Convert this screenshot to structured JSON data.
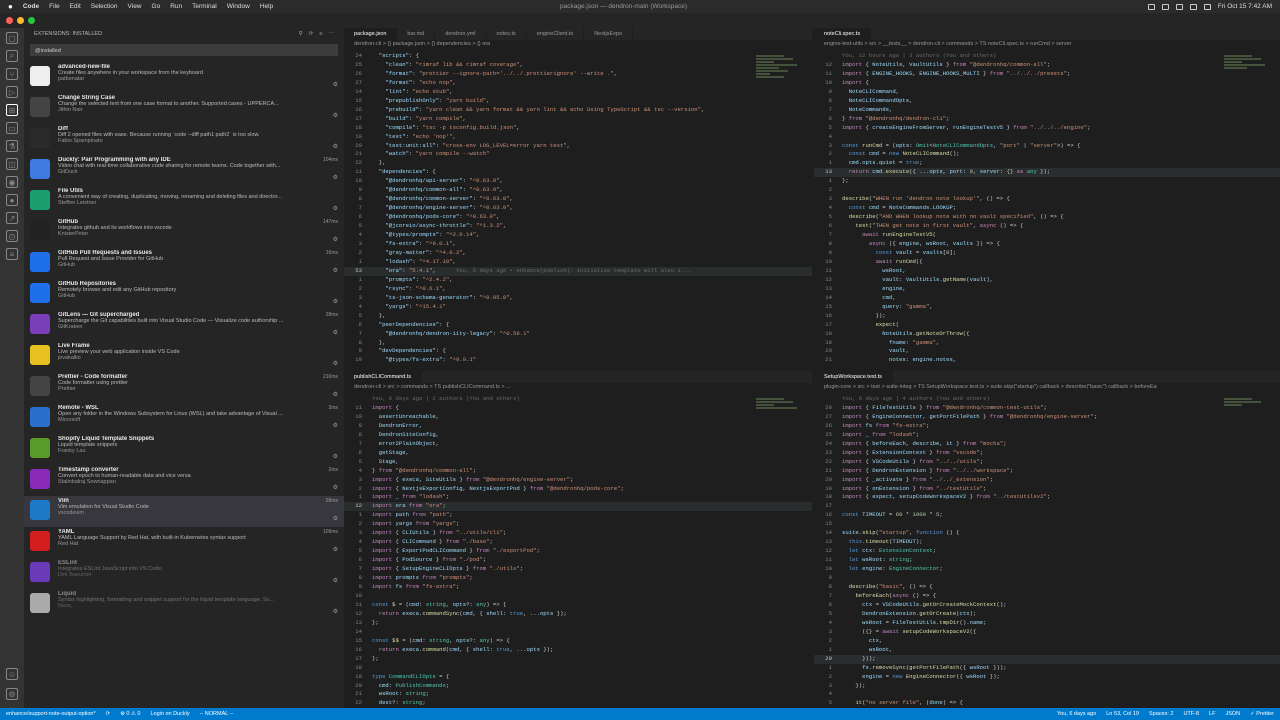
{
  "mac": {
    "app": "Code",
    "menu": [
      "File",
      "Edit",
      "Selection",
      "View",
      "Go",
      "Run",
      "Terminal",
      "Window",
      "Help"
    ],
    "center": "package.json — dendron-main (Workspace)",
    "time": "Fri Oct 15  7:42 AM"
  },
  "ext": {
    "title": "EXTENSIONS: INSTALLED",
    "search": "@installed",
    "items": [
      {
        "name": "advanced-new-file",
        "desc": "Create files anywhere in your workspace from the keyboard",
        "pub": "patbenatar",
        "dl": "",
        "color": "#eee",
        "icon": "file-icon"
      },
      {
        "name": "Change String Case",
        "desc": "Change the selected text from one case format to another. Supported cases - UPPERCA...",
        "pub": "Jithin Nair",
        "dl": "",
        "color": "#444",
        "icon": "text-icon"
      },
      {
        "name": "Diff",
        "desc": "Diff 2 opened files with ease. Because running `code --diff path1 path2` is too slow.",
        "pub": "Fabio Spampinato",
        "dl": "",
        "color": "#2a2a2a",
        "icon": "diff-icon"
      },
      {
        "name": "Duckly: Pair Programming with any IDE",
        "desc": "Video chat with real-time collaborative code sharing for remote teams. Code together with...",
        "pub": "GitDuck",
        "dl": "104ms",
        "color": "#3d7be0",
        "icon": "duck-icon"
      },
      {
        "name": "File Utils",
        "desc": "A convenient way of creating, duplicating, moving, renaming and deleting files and director...",
        "pub": "Steffen Leistner",
        "dl": "",
        "color": "#1a9d6f",
        "icon": "folder-icon"
      },
      {
        "name": "GitHub",
        "desc": "Integrates github and its workflows into vscode",
        "pub": "KnisterPeter",
        "dl": "147ms",
        "color": "#222",
        "icon": "github-icon"
      },
      {
        "name": "GitHub Pull Requests and Issues",
        "desc": "Pull Request and Issue Provider for GitHub",
        "pub": "GitHub",
        "dl": "16ms",
        "color": "#1f6feb",
        "icon": "pr-icon"
      },
      {
        "name": "GitHub Repositories",
        "desc": "Remotely browse and edit any GitHub repository",
        "pub": "GitHub",
        "dl": "",
        "color": "#1f6feb",
        "icon": "repo-icon"
      },
      {
        "name": "GitLens — Git supercharged",
        "desc": "Supercharge the Git capabilities built into Visual Studio Code — Visualize code authorship ...",
        "pub": "GitKraken",
        "dl": "28ms",
        "color": "#7a3fb8",
        "icon": "gitlens-icon"
      },
      {
        "name": "Live Frame",
        "desc": "Live preview your web application inside VS Code",
        "pub": "jevakallio",
        "dl": "",
        "color": "#e8c020",
        "icon": "frame-icon"
      },
      {
        "name": "Prettier - Code formatter",
        "desc": "Code formatter using prettier",
        "pub": "Prettier",
        "dl": "216ms",
        "color": "#444",
        "icon": "prettier-icon"
      },
      {
        "name": "Remote - WSL",
        "desc": "Open any folder in the Windows Subsystem for Linux (WSL) and take advantage of Visual ...",
        "pub": "Microsoft",
        "dl": "3ms",
        "color": "#2a6fc9",
        "icon": "remote-icon"
      },
      {
        "name": "Shopify Liquid Template Snippets",
        "desc": "Liquid template snippets",
        "pub": "Franky Lau",
        "dl": "",
        "color": "#5a9c2a",
        "icon": "shopify-icon"
      },
      {
        "name": "Timestamp converter",
        "desc": "Convert epoch to human-readable data and vice versa",
        "pub": "Stalinbalraj Sowriappan",
        "dl": "2ms",
        "color": "#8a2ab8",
        "icon": "clock-icon"
      },
      {
        "name": "Vim",
        "desc": "Vim emulation for Visual Studio Code",
        "pub": "vscodevim",
        "dl": "58ms",
        "color": "#1e78c8",
        "icon": "vim-icon"
      },
      {
        "name": "YAML",
        "desc": "YAML Language Support by Red Hat, with built-in Kubernetes syntax support",
        "pub": "Red Hat",
        "dl": "109ms",
        "color": "#d41e1e",
        "icon": "redhat-icon"
      },
      {
        "name": "ESLint",
        "desc": "Integrates ESLint JavaScript into VS Code.",
        "pub": "Dirk Baeumer",
        "dl": "",
        "color": "#6a3ab8",
        "icon": "eslint-icon"
      },
      {
        "name": "Liquid",
        "desc": "Syntax highlighting, formatting and snippet support for the liquid template language. Su...",
        "pub": "Νικος",
        "dl": "",
        "color": "#aaa",
        "icon": "liquid-icon"
      }
    ]
  },
  "p1": {
    "tabs": [
      "package.json",
      "bar.md",
      "dendron.yml",
      "notes.ts",
      "engineClient.ts",
      "NextjsExpo"
    ],
    "crumb": "dendron-cli  >  {} package.json  >  {} dependencies  >  {} ora"
  },
  "p2": {
    "tabs": [
      "noteCli.spec.ts"
    ],
    "crumb": "engine-test-utils > src > __tests__ > dendron-cli > commands > TS noteCli.spec.ts > runCmd > server"
  },
  "p3": {
    "tabs": [
      "publishCLICommand.ts"
    ],
    "crumb": "dendron-cli > src > commands > TS publishCLICommand.ts > ..."
  },
  "p4": {
    "tabs": [
      "SetupWorkspace.test.ts"
    ],
    "crumb": "plugin-core > src > test > suite-integ > TS SetupWorkspace.test.ts > suite.skip(\"startup\") callback > describe(\"basic\") callback > beforeEa"
  },
  "status": {
    "branch": "enhance/support-note-output-option*",
    "sync": "⟳",
    "errors": "⊗ 0  ⚠ 0",
    "duckly": "Login on Duckly",
    "mode": "-- NORMAL --",
    "blame": "You, 6 days ago",
    "pos": "Ln 53, Col 19",
    "spaces": "Spaces: 2",
    "enc": "UTF-8",
    "eol": "LF",
    "lang": "JSON",
    "prettier": "✓ Prettier"
  }
}
